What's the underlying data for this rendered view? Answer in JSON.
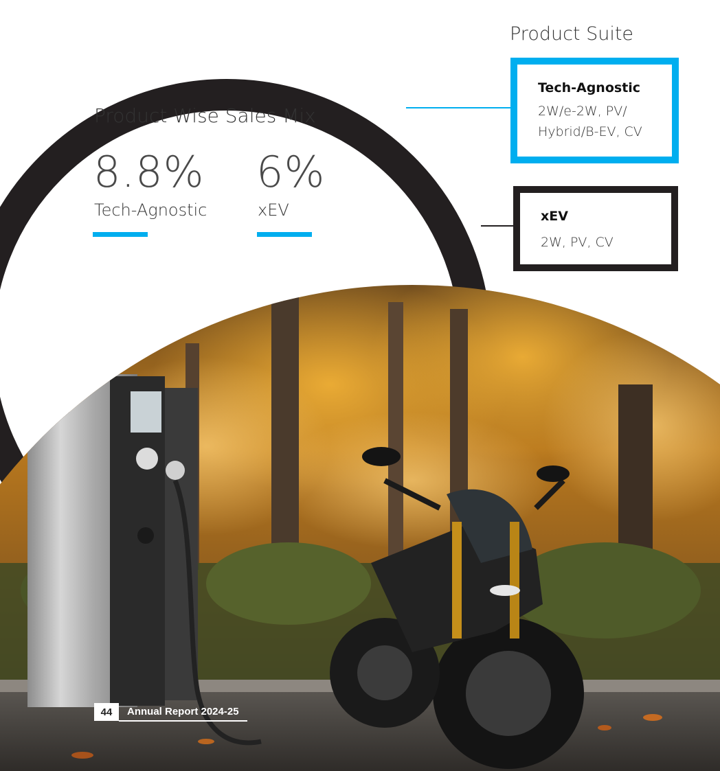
{
  "sales_mix": {
    "title": "Product Wise Sales Mix",
    "stats": [
      {
        "value": "8.8%",
        "label": "Tech-Agnostic"
      },
      {
        "value": "6%",
        "label": "xEV"
      }
    ],
    "bar_color": "#00aeef"
  },
  "product_suite": {
    "title": "Product Suite",
    "boxes": [
      {
        "heading": "Tech-Agnostic",
        "text": "2W/e-2W, PV/ Hybrid/B-EV, CV",
        "border_color": "#00aeef"
      },
      {
        "heading": "xEV",
        "text": "2W, PV, CV",
        "border_color": "#231f20"
      }
    ]
  },
  "photo": {
    "subject": "Electric motorcycle parked beside an EV charging station in an autumn forest"
  },
  "footer": {
    "page_number": "44",
    "report_title": "Annual Report 2024-25"
  },
  "colors": {
    "accent": "#00aeef",
    "ring": "#231f20"
  }
}
